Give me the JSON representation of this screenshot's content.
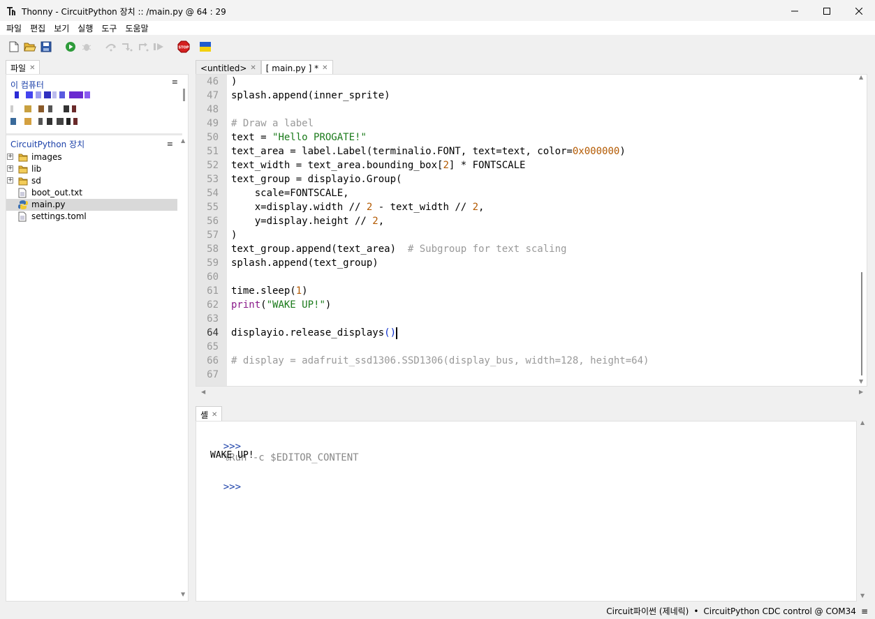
{
  "window": {
    "title": "Thonny  -  CircuitPython 장치 :: /main.py  @  64 : 29"
  },
  "menu": [
    "파일",
    "편집",
    "보기",
    "실행",
    "도구",
    "도움말"
  ],
  "toolbar": {
    "buttons": [
      "new-file-icon",
      "open-folder-icon",
      "save-icon",
      "run-icon",
      "debug-bug-icon",
      "step-over-icon",
      "step-into-icon",
      "step-out-icon",
      "resume-icon",
      "stop-icon",
      "ukraine-flag-icon"
    ],
    "stop_label": "STOP"
  },
  "files_panel": {
    "tab": "파일",
    "this_computer": "이 컴퓨터",
    "device_heading": "CircuitPython 장치",
    "items": [
      {
        "name": "images",
        "type": "folder"
      },
      {
        "name": "lib",
        "type": "folder"
      },
      {
        "name": "sd",
        "type": "folder"
      },
      {
        "name": "boot_out.txt",
        "type": "file"
      },
      {
        "name": "main.py",
        "type": "python",
        "selected": true
      },
      {
        "name": "settings.toml",
        "type": "file"
      }
    ]
  },
  "editor": {
    "tabs": [
      {
        "label": "<untitled>",
        "active": false
      },
      {
        "label": "[ main.py ] *",
        "active": true
      }
    ],
    "current_line": 64,
    "lines": [
      {
        "n": 46,
        "tokens": [
          {
            "t": ")",
            "c": ""
          }
        ]
      },
      {
        "n": 47,
        "tokens": [
          {
            "t": "splash.append(inner_sprite)",
            "c": ""
          }
        ]
      },
      {
        "n": 48,
        "tokens": []
      },
      {
        "n": 49,
        "tokens": [
          {
            "t": "# Draw a label",
            "c": "comment"
          }
        ]
      },
      {
        "n": 50,
        "tokens": [
          {
            "t": "text = ",
            "c": ""
          },
          {
            "t": "\"Hello PROGATE!\"",
            "c": "str"
          }
        ]
      },
      {
        "n": 51,
        "tokens": [
          {
            "t": "text_area = label.Label(terminalio.FONT, text=text, color=",
            "c": ""
          },
          {
            "t": "0x000000",
            "c": "num"
          },
          {
            "t": ")",
            "c": ""
          }
        ]
      },
      {
        "n": 52,
        "tokens": [
          {
            "t": "text_width = text_area.bounding_box[",
            "c": ""
          },
          {
            "t": "2",
            "c": "num"
          },
          {
            "t": "] * FONTSCALE",
            "c": ""
          }
        ]
      },
      {
        "n": 53,
        "tokens": [
          {
            "t": "text_group = displayio.Group(",
            "c": ""
          }
        ]
      },
      {
        "n": 54,
        "tokens": [
          {
            "t": "    scale=FONTSCALE,",
            "c": ""
          }
        ]
      },
      {
        "n": 55,
        "tokens": [
          {
            "t": "    x=display.width // ",
            "c": ""
          },
          {
            "t": "2",
            "c": "num"
          },
          {
            "t": " - text_width // ",
            "c": ""
          },
          {
            "t": "2",
            "c": "num"
          },
          {
            "t": ",",
            "c": ""
          }
        ]
      },
      {
        "n": 56,
        "tokens": [
          {
            "t": "    y=display.height // ",
            "c": ""
          },
          {
            "t": "2",
            "c": "num"
          },
          {
            "t": ",",
            "c": ""
          }
        ]
      },
      {
        "n": 57,
        "tokens": [
          {
            "t": ")",
            "c": ""
          }
        ]
      },
      {
        "n": 58,
        "tokens": [
          {
            "t": "text_group.append(text_area)  ",
            "c": ""
          },
          {
            "t": "# Subgroup for text scaling",
            "c": "comment"
          }
        ]
      },
      {
        "n": 59,
        "tokens": [
          {
            "t": "splash.append(text_group)",
            "c": ""
          }
        ]
      },
      {
        "n": 60,
        "tokens": []
      },
      {
        "n": 61,
        "tokens": [
          {
            "t": "time.sleep(",
            "c": ""
          },
          {
            "t": "1",
            "c": "num"
          },
          {
            "t": ")",
            "c": ""
          }
        ]
      },
      {
        "n": 62,
        "tokens": [
          {
            "t": "print",
            "c": "kw"
          },
          {
            "t": "(",
            "c": ""
          },
          {
            "t": "\"WAKE UP!\"",
            "c": "str"
          },
          {
            "t": ")",
            "c": ""
          }
        ]
      },
      {
        "n": 63,
        "tokens": []
      },
      {
        "n": 64,
        "tokens": [
          {
            "t": "displayio.release_displays",
            "c": ""
          },
          {
            "t": "()",
            "c": "paren"
          }
        ],
        "cursor": true
      },
      {
        "n": 65,
        "tokens": []
      },
      {
        "n": 66,
        "tokens": [
          {
            "t": "# display = adafruit_ssd1306.SSD1306(display_bus, width=128, height=64)",
            "c": "comment"
          }
        ]
      },
      {
        "n": 67,
        "tokens": []
      }
    ]
  },
  "shell": {
    "tab": "셸",
    "prompt": ">>>",
    "command": "%Run -c $EDITOR_CONTENT",
    "output": "WAKE UP!"
  },
  "status": {
    "interpreter": "Circuit파이썬 (제네릭)",
    "separator": "•",
    "port": "CircuitPython CDC control @ COM34",
    "menu_glyph": "≡"
  },
  "colors": {
    "comment": "#999999",
    "string": "#1a7a1a",
    "number": "#b35900",
    "keyword": "#8a1a8a",
    "heading_blue": "#1a3fa8"
  }
}
